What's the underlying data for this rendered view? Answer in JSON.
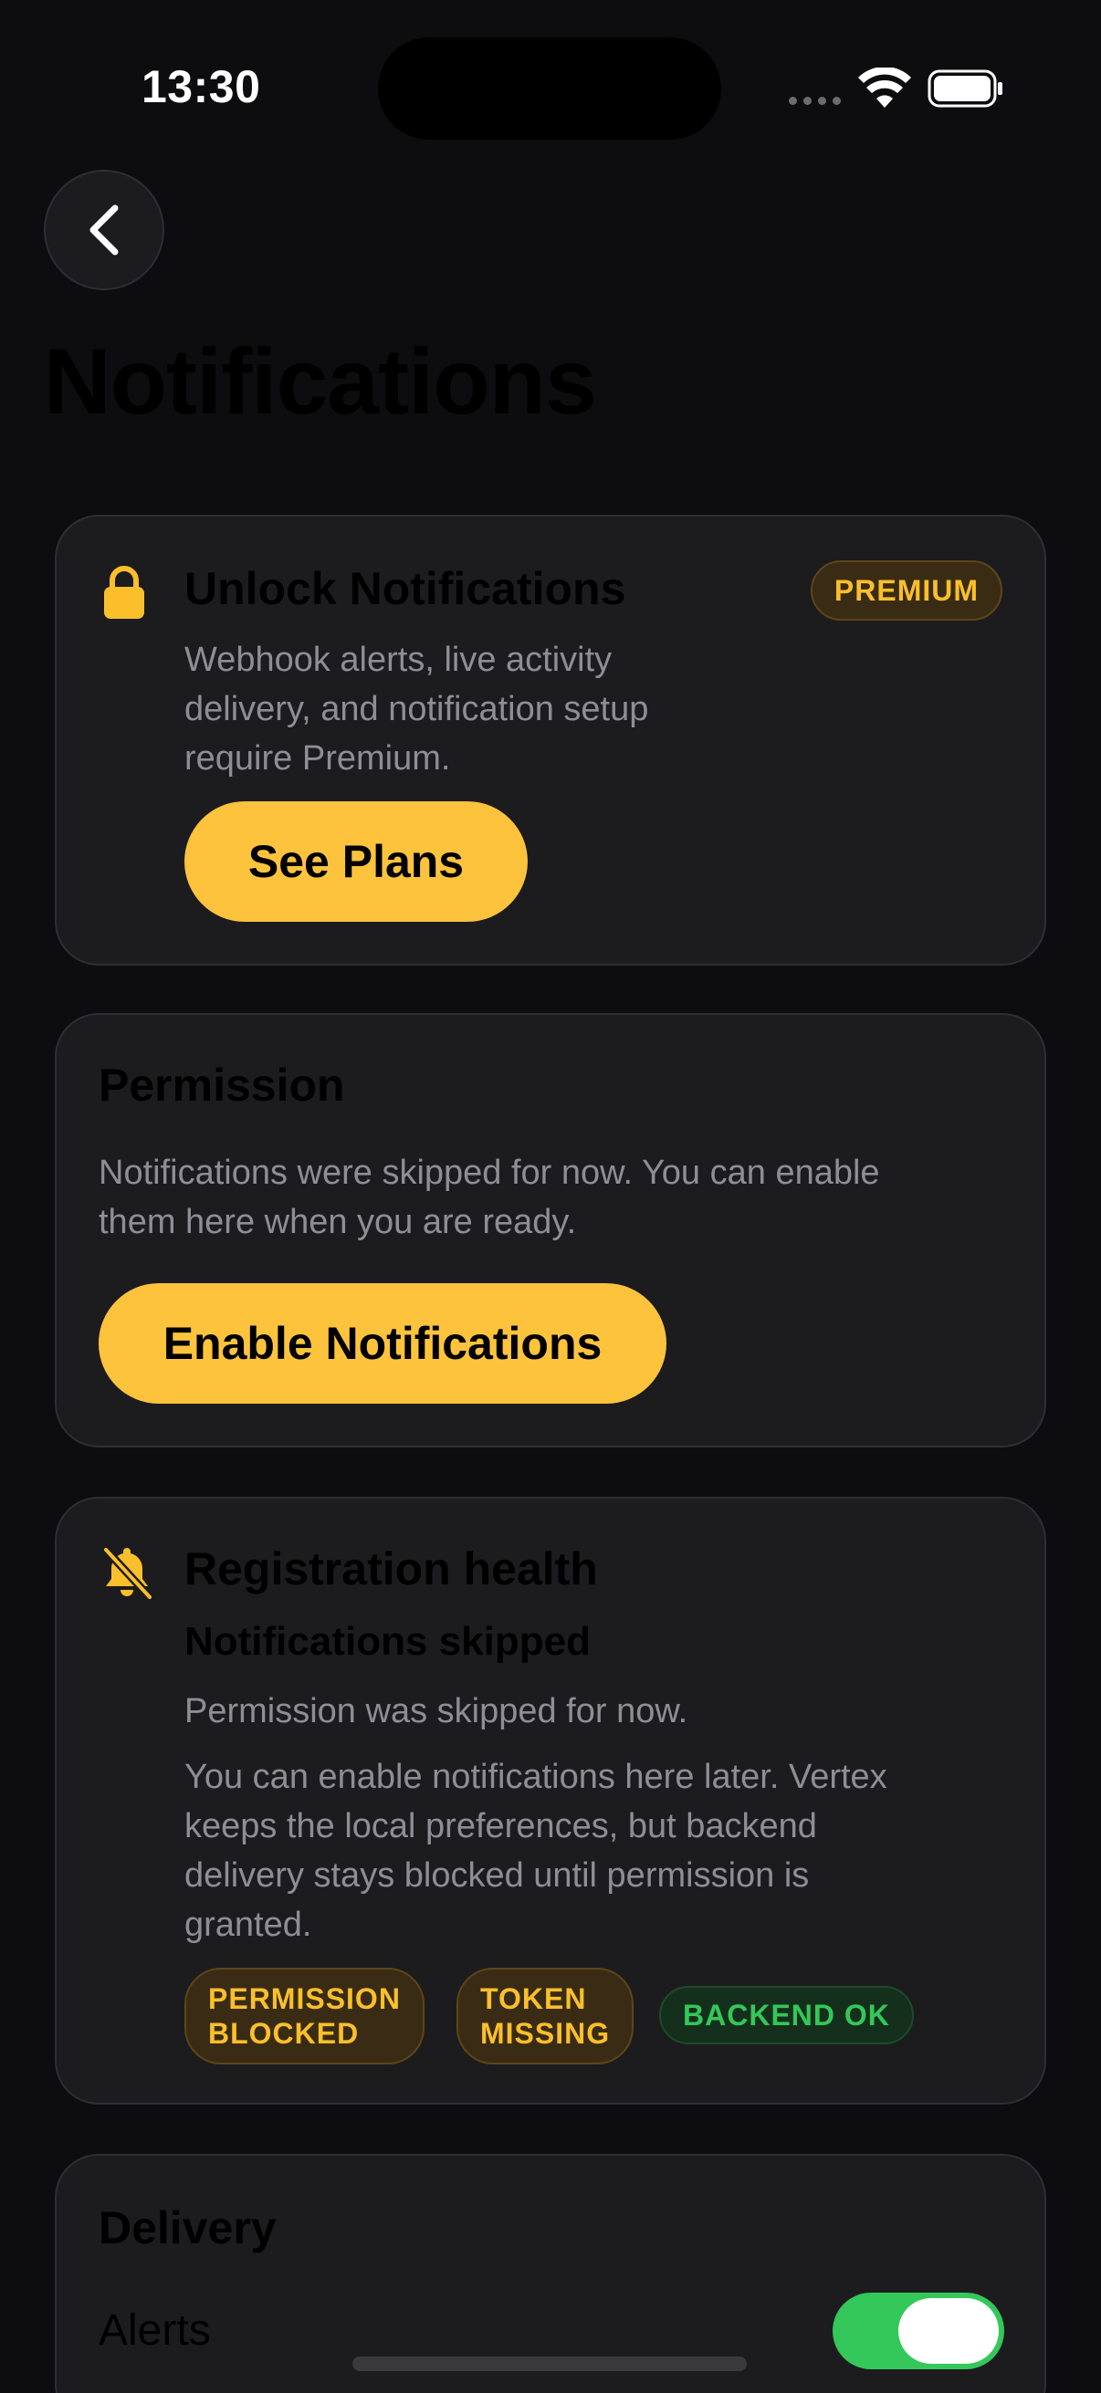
{
  "status_bar": {
    "time": "13:30"
  },
  "header": {
    "title": "Notifications"
  },
  "premium_card": {
    "title": "Unlock Notifications",
    "badge": "PREMIUM",
    "description_lines": [
      "Webhook alerts, live activity",
      "delivery, and notification setup",
      "require Premium."
    ],
    "button_label": "See Plans"
  },
  "permission_card": {
    "title": "Permission",
    "description_lines": [
      "Notifications were skipped for now. You can enable",
      "them here when you are ready."
    ],
    "button_label": "Enable Notifications"
  },
  "health_card": {
    "title": "Registration health",
    "status": "Notifications skipped",
    "summary": "Permission was skipped for now.",
    "detail_lines": [
      "You can enable notifications here later. Vertex",
      "keeps the local preferences, but backend",
      "delivery stays blocked until permission is",
      "granted."
    ],
    "tags": [
      {
        "line1": "PERMISSION",
        "line2": "BLOCKED"
      },
      {
        "line1": "TOKEN",
        "line2": "MISSING"
      },
      {
        "label": "BACKEND OK"
      }
    ]
  },
  "delivery_card": {
    "title": "Delivery",
    "alerts_label": "Alerts",
    "alerts_enabled": true
  },
  "colors": {
    "background": "#0d0d0f",
    "card": "#1c1c1f",
    "accent": "#fec33d",
    "warning_text": "#fbbf2c",
    "success": "#34c759",
    "muted_text": "#8e8e93"
  },
  "icons": [
    "back-chevron-icon",
    "lock-icon",
    "bell-slash-icon",
    "wifi-icon",
    "battery-icon"
  ]
}
